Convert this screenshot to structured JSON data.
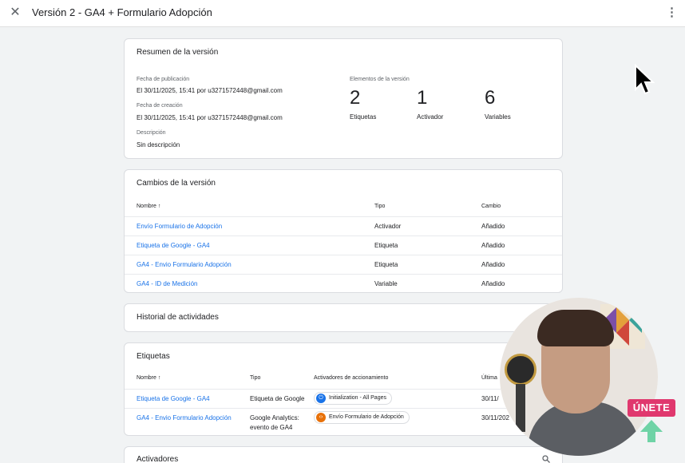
{
  "header": {
    "title": "Versión 2 - GA4 + Formulario Adopción",
    "close_icon": "close-icon",
    "more_icon": "more-vert-icon"
  },
  "summary": {
    "title": "Resumen de la versión",
    "published_label": "Fecha de publicación",
    "published_value": "El 30/11/2025, 15:41 por u3271572448@gmail.com",
    "created_label": "Fecha de creación",
    "created_value": "El 30/11/2025, 15:41 por u3271572448@gmail.com",
    "description_label": "Descripción",
    "description_value": "Sin descripción",
    "elements_label": "Elementos de la versión",
    "counts": [
      {
        "value": "2",
        "label": "Etiquetas"
      },
      {
        "value": "1",
        "label": "Activador"
      },
      {
        "value": "6",
        "label": "Variables"
      }
    ]
  },
  "changes": {
    "title": "Cambios de la versión",
    "columns": [
      "Nombre",
      "Tipo",
      "Cambio"
    ],
    "sort_icon": "arrow-up-icon",
    "rows": [
      {
        "name": "Envío Formulario de Adopción",
        "type": "Activador",
        "change": "Añadido"
      },
      {
        "name": "Etiqueta de Google - GA4",
        "type": "Etiqueta",
        "change": "Añadido"
      },
      {
        "name": "GA4 - Envio Formulario Adopción",
        "type": "Etiqueta",
        "change": "Añadido"
      },
      {
        "name": "GA4 - ID de Medición",
        "type": "Variable",
        "change": "Añadido"
      }
    ]
  },
  "history": {
    "title": "Historial de actividades"
  },
  "tags": {
    "title": "Etiquetas",
    "columns": [
      "Nombre",
      "Tipo",
      "Activadores de accionamiento",
      "Última"
    ],
    "rows": [
      {
        "name": "Etiqueta de Google - GA4",
        "type": "Etiqueta de Google",
        "type2": "",
        "trigger": "Initialization - All Pages",
        "trigger_color": "#1a73e8",
        "last": "30/11/"
      },
      {
        "name": "GA4 - Envio Formulario Adopción",
        "type": "Google Analytics:",
        "type2": "evento de GA4",
        "trigger": "Envío Formulario de Adopción",
        "trigger_color": "#e8710a",
        "last": "30/11/202"
      }
    ]
  },
  "triggers": {
    "title": "Activadores",
    "search_icon": "search-icon"
  },
  "overlay": {
    "join_label": "ÚNETE",
    "join_color": "#e0386e",
    "arrow_color": "#6fd3a6"
  }
}
